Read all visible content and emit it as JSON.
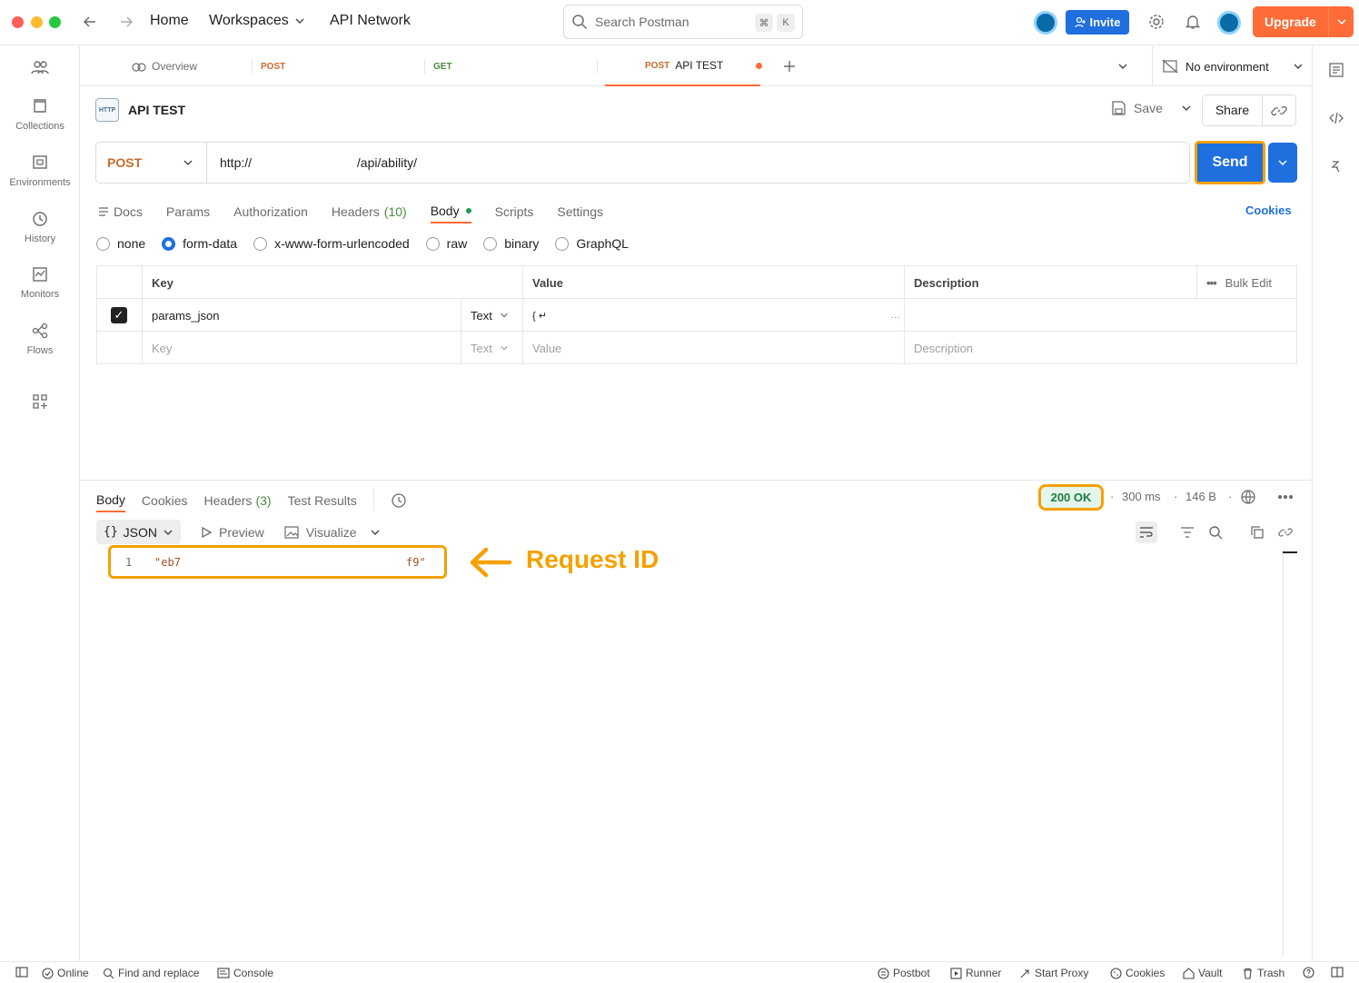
{
  "titlebar": {
    "nav": {
      "home": "Home",
      "workspaces": "Workspaces",
      "api_network": "API Network"
    },
    "search": {
      "placeholder": "Search Postman",
      "key1": "⌘",
      "key2": "K"
    },
    "invite_label": "Invite",
    "upgrade_label": "Upgrade"
  },
  "sidebar": {
    "items": [
      {
        "label": "Collections"
      },
      {
        "label": "Environments"
      },
      {
        "label": "History"
      },
      {
        "label": "Monitors"
      },
      {
        "label": "Flows"
      }
    ]
  },
  "tabs": [
    {
      "label": "Overview"
    },
    {
      "method": "POST",
      "label": ""
    },
    {
      "method": "GET",
      "label": ""
    },
    {
      "method": "POST",
      "label": "API TEST"
    }
  ],
  "environment": {
    "label": "No environment"
  },
  "request": {
    "title": "API TEST",
    "badge": "HTTP",
    "save_label": "Save",
    "share_label": "Share",
    "method": "POST",
    "url_prefix": "http://",
    "url_suffix": "/api/ability/",
    "send_label": "Send",
    "subtabs": {
      "docs": "Docs",
      "params": "Params",
      "authorization": "Authorization",
      "headers": "Headers",
      "headers_count": "(10)",
      "body": "Body",
      "scripts": "Scripts",
      "settings": "Settings"
    },
    "cookies_label": "Cookies",
    "body_types": [
      "none",
      "form-data",
      "x-www-form-urlencoded",
      "raw",
      "binary",
      "GraphQL"
    ],
    "selected_body_type": "form-data",
    "table": {
      "headers": {
        "key": "Key",
        "value": "Value",
        "description": "Description",
        "bulk_edit": "Bulk Edit"
      },
      "rows": [
        {
          "key": "params_json",
          "type": "Text",
          "value": "{ ↵",
          "checked": true
        }
      ],
      "placeholder": {
        "key": "Key",
        "type": "Text",
        "value": "Value",
        "description": "Description"
      }
    }
  },
  "response": {
    "tabs": {
      "body": "Body",
      "cookies": "Cookies",
      "headers": "Headers",
      "headers_count": "(3)",
      "test_results": "Test Results"
    },
    "status": "200 OK",
    "time": "300 ms",
    "size": "146 B",
    "format": "JSON",
    "preview_label": "Preview",
    "visualize_label": "Visualize",
    "line_number": "1",
    "value_start": "\"eb7",
    "value_end": "f9\"",
    "annotation": "Request ID",
    "annotation_color": "#f4a100"
  },
  "statusbar": {
    "online": "Online",
    "find_replace": "Find and replace",
    "console": "Console",
    "postbot": "Postbot",
    "runner": "Runner",
    "start_proxy": "Start Proxy",
    "cookies": "Cookies",
    "vault": "Vault",
    "trash": "Trash"
  },
  "colors": {
    "accent": "#ff6c37",
    "primary": "#1f6fde",
    "highlight": "#f4a100",
    "success": "#1c7c3e"
  }
}
